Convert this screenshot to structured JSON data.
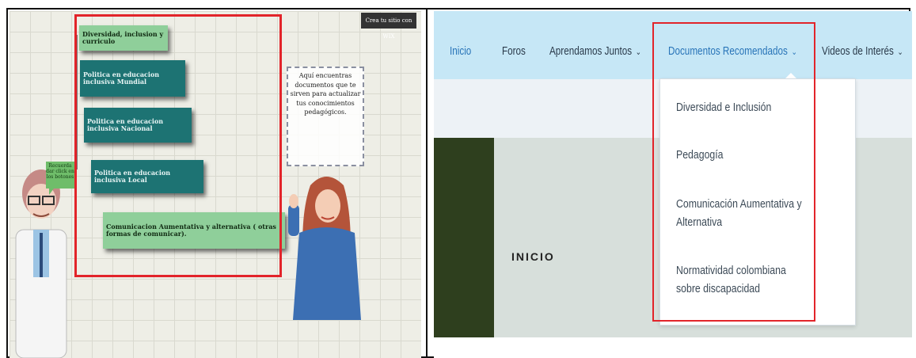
{
  "left_panel": {
    "wix_badge": "Crea tu sitio con WIX",
    "cards": [
      "Diversidad, inclusion y curriculo",
      "Politica en educacion inclusiva Mundial",
      "Politica en educacion inclusiva Nacional",
      "Politica en educacion inclusiva Local",
      "Comunicacion Aumentativa y alternativa ( otras formas de comunicar)."
    ],
    "note": "Aquí encuentras documentos que te sirven para actualizar tus conocimientos pedagógicos.",
    "bubble": "Recuerda dar click en los botones",
    "highlight_color": "#e2242a"
  },
  "right_panel": {
    "nav": [
      {
        "label": "Inicio",
        "has_menu": false
      },
      {
        "label": "Foros",
        "has_menu": false
      },
      {
        "label": "Aprendamos Juntos",
        "has_menu": true
      },
      {
        "label": "Documentos Recomendados",
        "has_menu": true
      },
      {
        "label": "Videos de Interés",
        "has_menu": true
      }
    ],
    "chevron_icon": "chevron-down-icon",
    "dropdown": [
      "Diversidad e Inclusión",
      "Pedagogía",
      "Comunicación Aumentativa y Alternativa",
      "Normatividad colombiana sobre discapacidad"
    ],
    "hero_title": "INICIO",
    "colors": {
      "nav_bg": "#c6e7f6",
      "accent": "#2874b8",
      "highlight": "#e2242a"
    }
  }
}
